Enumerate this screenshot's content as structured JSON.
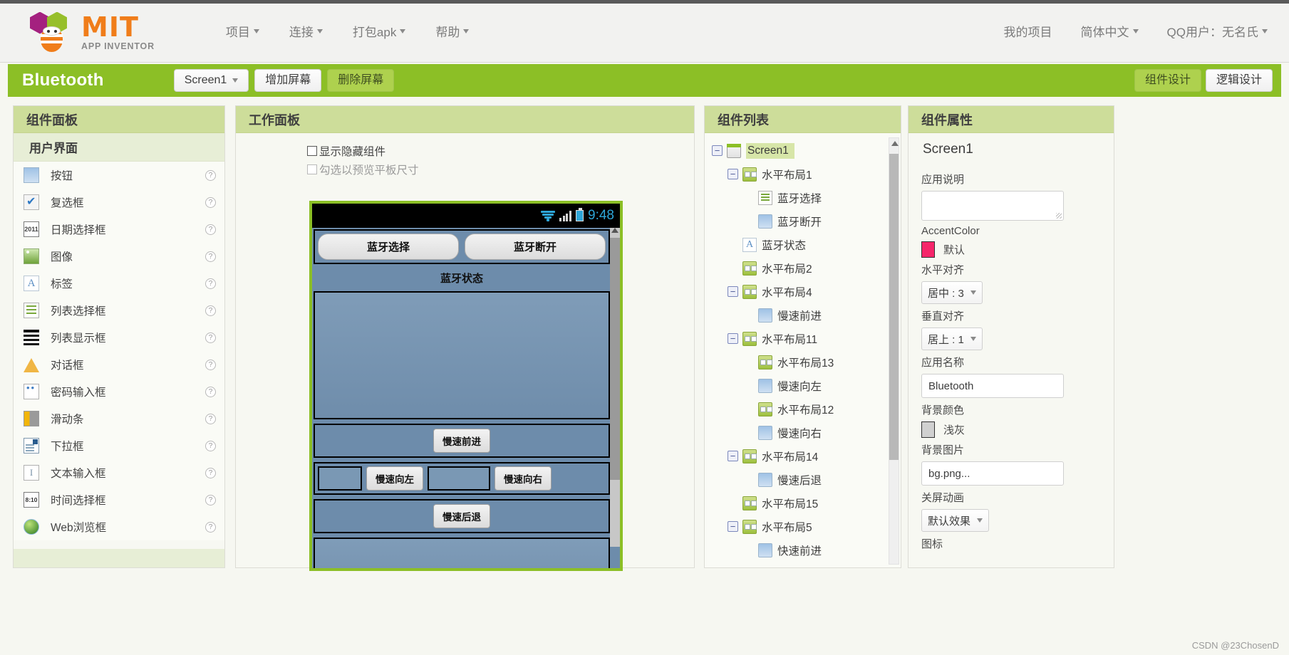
{
  "header": {
    "logo": {
      "title": "MIT",
      "subtitle": "APP INVENTOR"
    },
    "menu": [
      {
        "label": "项目",
        "has_caret": true
      },
      {
        "label": "连接",
        "has_caret": true
      },
      {
        "label": "打包apk",
        "has_caret": true
      },
      {
        "label": "帮助",
        "has_caret": true
      }
    ],
    "right_menu": [
      {
        "label": "我的项目",
        "has_caret": false
      },
      {
        "label": "简体中文",
        "has_caret": true
      },
      {
        "label": "QQ用户：无名氏",
        "has_caret": true
      }
    ]
  },
  "toolbar": {
    "project_name": "Bluetooth",
    "screen_select": "Screen1",
    "add_screen": "增加屏幕",
    "remove_screen": "删除屏幕",
    "designer_tab": "组件设计",
    "blocks_tab": "逻辑设计"
  },
  "palette": {
    "title": "组件面板",
    "group": "用户界面",
    "items": [
      {
        "label": "按钮",
        "icon": "button-icon"
      },
      {
        "label": "复选框",
        "icon": "checkbox-icon"
      },
      {
        "label": "日期选择框",
        "icon": "datepicker-icon",
        "icon_text": "2011"
      },
      {
        "label": "图像",
        "icon": "image-icon"
      },
      {
        "label": "标签",
        "icon": "label-icon",
        "icon_text": "A"
      },
      {
        "label": "列表选择框",
        "icon": "listpicker-icon"
      },
      {
        "label": "列表显示框",
        "icon": "listview-icon"
      },
      {
        "label": "对话框",
        "icon": "notifier-icon"
      },
      {
        "label": "密码输入框",
        "icon": "passwordbox-icon"
      },
      {
        "label": "滑动条",
        "icon": "slider-icon"
      },
      {
        "label": "下拉框",
        "icon": "spinner-icon"
      },
      {
        "label": "文本输入框",
        "icon": "textbox-icon",
        "icon_text": "I"
      },
      {
        "label": "时间选择框",
        "icon": "timepicker-icon",
        "icon_text": "8:10"
      },
      {
        "label": "Web浏览框",
        "icon": "web-viewer-icon"
      }
    ],
    "help_glyph": "?"
  },
  "viewer": {
    "title": "工作面板",
    "show_hidden_label": "显示隐藏组件",
    "tablet_preview_label": "勾选以预览平板尺寸",
    "show_hidden_checked": false,
    "tablet_preview_checked": false,
    "phone": {
      "status_time": "9:48",
      "row1": [
        "蓝牙选择",
        "蓝牙断开"
      ],
      "status_label": "蓝牙状态",
      "forward": "慢速前进",
      "left": "慢速向左",
      "right": "慢速向右",
      "backward": "慢速后退"
    }
  },
  "tree": {
    "title": "组件列表",
    "nodes": [
      {
        "label": "Screen1",
        "depth": 0,
        "expander": "−",
        "icon": "screen-icon",
        "selected": true
      },
      {
        "label": "水平布局1",
        "depth": 1,
        "expander": "−",
        "icon": "hlayout-icon",
        "selected": false
      },
      {
        "label": "蓝牙选择",
        "depth": 2,
        "expander": "",
        "icon": "listpicker-icon",
        "selected": false
      },
      {
        "label": "蓝牙断开",
        "depth": 2,
        "expander": "",
        "icon": "button-icon",
        "selected": false
      },
      {
        "label": "蓝牙状态",
        "depth": 1,
        "expander": "",
        "icon": "label-icon",
        "selected": false
      },
      {
        "label": "水平布局2",
        "depth": 1,
        "expander": "",
        "icon": "hlayout-icon",
        "selected": false
      },
      {
        "label": "水平布局4",
        "depth": 1,
        "expander": "−",
        "icon": "hlayout-icon",
        "selected": false
      },
      {
        "label": "慢速前进",
        "depth": 2,
        "expander": "",
        "icon": "button-icon",
        "selected": false
      },
      {
        "label": "水平布局11",
        "depth": 1,
        "expander": "−",
        "icon": "hlayout-icon",
        "selected": false
      },
      {
        "label": "水平布局13",
        "depth": 2,
        "expander": "",
        "icon": "hlayout-icon",
        "selected": false
      },
      {
        "label": "慢速向左",
        "depth": 2,
        "expander": "",
        "icon": "button-icon",
        "selected": false
      },
      {
        "label": "水平布局12",
        "depth": 2,
        "expander": "",
        "icon": "hlayout-icon",
        "selected": false
      },
      {
        "label": "慢速向右",
        "depth": 2,
        "expander": "",
        "icon": "button-icon",
        "selected": false
      },
      {
        "label": "水平布局14",
        "depth": 1,
        "expander": "−",
        "icon": "hlayout-icon",
        "selected": false
      },
      {
        "label": "慢速后退",
        "depth": 2,
        "expander": "",
        "icon": "button-icon",
        "selected": false
      },
      {
        "label": "水平布局15",
        "depth": 1,
        "expander": "",
        "icon": "hlayout-icon",
        "selected": false
      },
      {
        "label": "水平布局5",
        "depth": 1,
        "expander": "−",
        "icon": "hlayout-icon",
        "selected": false
      },
      {
        "label": "快速前进",
        "depth": 2,
        "expander": "",
        "icon": "button-icon",
        "selected": false
      }
    ]
  },
  "properties": {
    "title": "组件属性",
    "component_name": "Screen1",
    "fields": [
      {
        "label": "应用说明",
        "type": "textarea",
        "value": ""
      },
      {
        "label": "AccentColor",
        "type": "color",
        "value": "默认",
        "color": "#f5256a"
      },
      {
        "label": "水平对齐",
        "type": "select",
        "value": "居中 : 3"
      },
      {
        "label": "垂直对齐",
        "type": "select",
        "value": "居上 : 1"
      },
      {
        "label": "应用名称",
        "type": "text",
        "value": "Bluetooth"
      },
      {
        "label": "背景颜色",
        "type": "color",
        "value": "浅灰",
        "color": "#d0d0d0"
      },
      {
        "label": "背景图片",
        "type": "text",
        "value": "bg.png..."
      },
      {
        "label": "关屏动画",
        "type": "select",
        "value": "默认效果"
      },
      {
        "label": "图标",
        "type": "text",
        "value": ""
      }
    ]
  },
  "watermark": "CSDN @23ChosenD",
  "colors": {
    "brand_green": "#8cbf26",
    "panel_head": "#cddd9a",
    "accent": "#f5256a"
  }
}
